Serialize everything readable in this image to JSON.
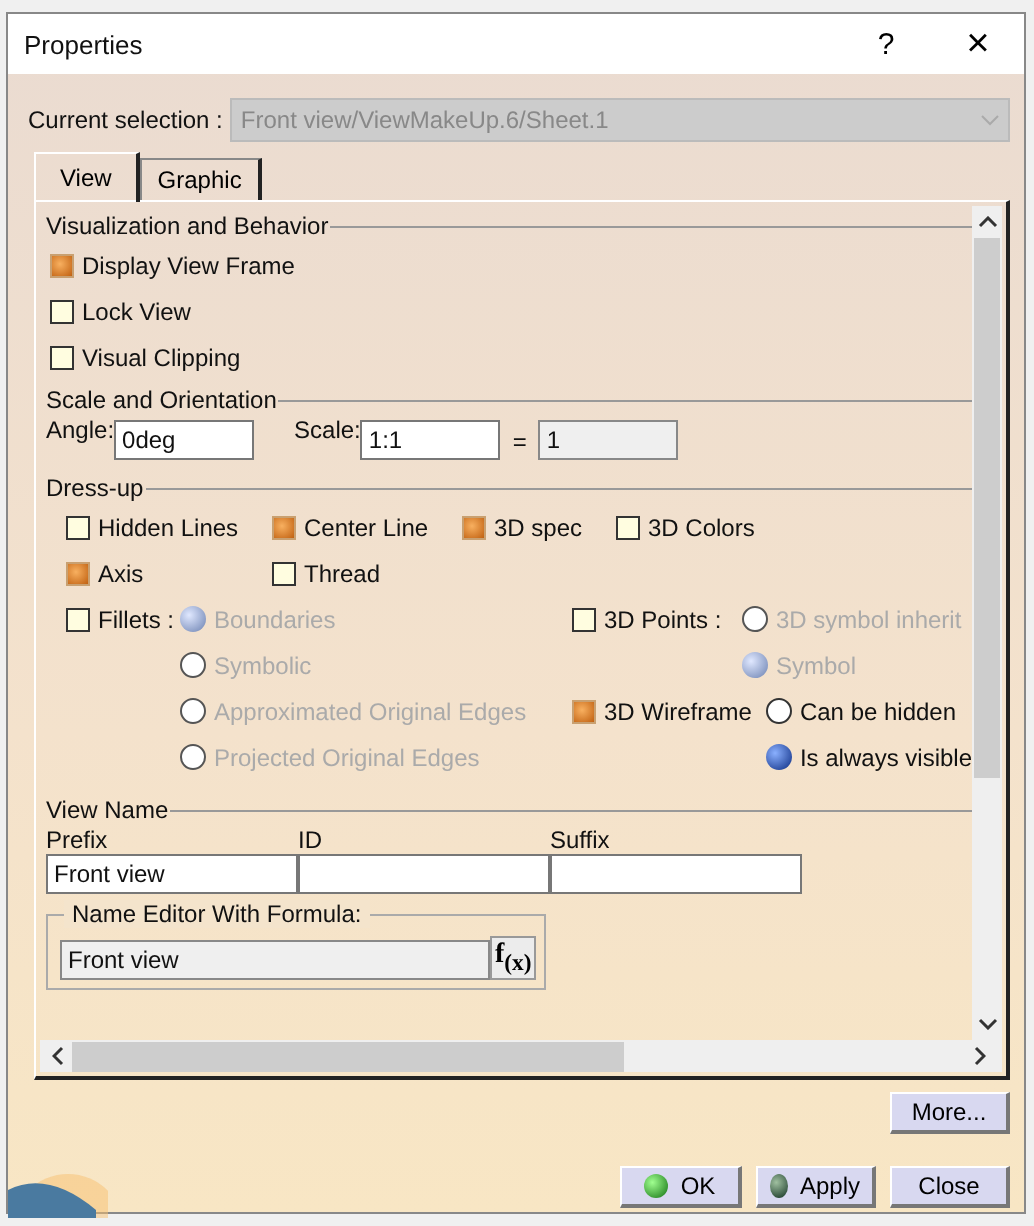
{
  "window": {
    "title": "Properties",
    "help": "?",
    "close": "×"
  },
  "selection": {
    "label": "Current selection :",
    "value": "Front view/ViewMakeUp.6/Sheet.1"
  },
  "tabs": [
    {
      "label": "View",
      "selected": true
    },
    {
      "label": "Graphic",
      "selected": false
    }
  ],
  "visualization": {
    "title": "Visualization and Behavior",
    "options": [
      {
        "label": "Display View Frame",
        "checked": true
      },
      {
        "label": "Lock View",
        "checked": false
      },
      {
        "label": "Visual Clipping",
        "checked": false
      }
    ]
  },
  "scale": {
    "title": "Scale and Orientation",
    "angle_label": "Angle:",
    "angle_value": "0deg",
    "scale_label": "Scale:",
    "scale_value": "1:1",
    "equals": "=",
    "result": "1"
  },
  "dressup": {
    "title": "Dress-up",
    "options": [
      {
        "label": "Hidden Lines",
        "checked": false
      },
      {
        "label": "Center Line",
        "checked": true
      },
      {
        "label": "3D spec",
        "checked": true
      },
      {
        "label": "3D Colors",
        "checked": false
      },
      {
        "label": "Axis",
        "checked": true
      },
      {
        "label": "Thread",
        "checked": false
      }
    ],
    "fillets": {
      "label": "Fillets :",
      "checked": false,
      "disabled": true,
      "options": [
        {
          "label": "Boundaries",
          "selected": true
        },
        {
          "label": "Symbolic",
          "selected": false
        },
        {
          "label": "Approximated Original Edges",
          "selected": false
        },
        {
          "label": "Projected Original Edges",
          "selected": false
        }
      ]
    },
    "points": {
      "label": "3D Points :",
      "checked": false,
      "disabled": true,
      "options": [
        {
          "label": "3D symbol inherit",
          "selected": false
        },
        {
          "label": "Symbol",
          "selected": true
        }
      ]
    },
    "wireframe": {
      "label": "3D Wireframe",
      "checked": true,
      "disabled": false,
      "options": [
        {
          "label": "Can be hidden",
          "selected": false
        },
        {
          "label": "Is always visible",
          "selected": true
        }
      ]
    }
  },
  "view_name": {
    "title": "View Name",
    "fields": [
      {
        "label": "Prefix",
        "value": "Front view"
      },
      {
        "label": "ID"
      },
      {
        "label": "Suffix"
      }
    ],
    "formula": {
      "title": "Name Editor With Formula:",
      "value": "Front view",
      "button": "f$_{(x)}$"
    }
  },
  "more_button": "More...",
  "actions": [
    {
      "label": "OK",
      "kind": "ok"
    },
    {
      "label": "Apply",
      "kind": "apply"
    },
    {
      "label": "Close",
      "kind": "plain"
    }
  ]
}
